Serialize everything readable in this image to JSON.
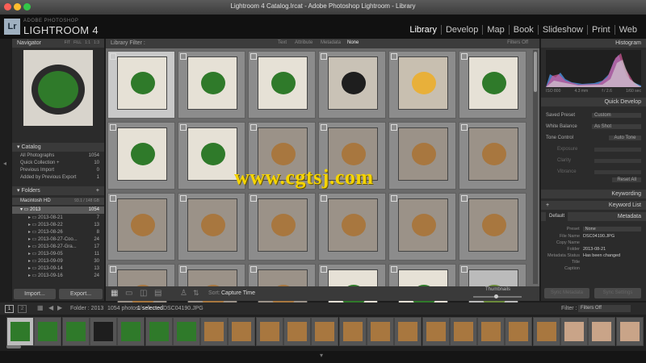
{
  "window": {
    "title": "Lightroom 4 Catalog.lrcat - Adobe Photoshop Lightroom - Library"
  },
  "brand": {
    "logo": "Lr",
    "sub": "ADOBE PHOTOSHOP",
    "main": "LIGHTROOM 4"
  },
  "modules": [
    "Library",
    "Develop",
    "Map",
    "Book",
    "Slideshow",
    "Print",
    "Web"
  ],
  "left": {
    "navigator": {
      "title": "Navigator",
      "zoom": [
        "FIT",
        "FILL",
        "1:1",
        "1:3"
      ]
    },
    "catalog": {
      "title": "Catalog",
      "items": [
        {
          "label": "All Photographs",
          "count": "1054"
        },
        {
          "label": "Quick Collection +",
          "count": "10"
        },
        {
          "label": "Previous Import",
          "count": "0"
        },
        {
          "label": "Added by Previous Export",
          "count": "1"
        }
      ]
    },
    "folders": {
      "title": "Folders",
      "volume": "Macintosh HD",
      "volume_space": "93.1 / 148 GB",
      "year": {
        "label": "2013",
        "count": "1054"
      },
      "items": [
        {
          "label": "2013-08-21",
          "count": "7"
        },
        {
          "label": "2013-08-22",
          "count": "13"
        },
        {
          "label": "2013-08-26",
          "count": "8"
        },
        {
          "label": "2013-08-27-Coo...",
          "count": "24"
        },
        {
          "label": "2013-08-27-Gra...",
          "count": "17"
        },
        {
          "label": "2013-09-05",
          "count": "11"
        },
        {
          "label": "2013-09-09",
          "count": "30"
        },
        {
          "label": "2013-09-14",
          "count": "13"
        },
        {
          "label": "2013-09-16",
          "count": "24"
        }
      ]
    },
    "import_label": "Import...",
    "export_label": "Export..."
  },
  "filter": {
    "label": "Library Filter :",
    "options": [
      "Text",
      "Attribute",
      "Metadata",
      "None"
    ],
    "active": "None",
    "preset": "Filters Off"
  },
  "toolbar": {
    "sort_label": "Sort:",
    "sort_value": "Capture Time",
    "thumbs_label": "Thumbnails"
  },
  "right": {
    "histogram": {
      "title": "Histogram",
      "iso": "ISO 800",
      "focal": "4.3 mm",
      "aperture": "f / 2.6",
      "shutter": "1/60 sec"
    },
    "quick_develop": {
      "title": "Quick Develop",
      "saved_preset_label": "Saved Preset",
      "saved_preset_value": "Custom",
      "wb_label": "White Balance",
      "wb_value": "As Shot",
      "tone_label": "Tone Control",
      "auto_tone": "Auto Tone",
      "exposure": "Exposure",
      "clarity": "Clarity",
      "vibrance": "Vibrance",
      "reset": "Reset All"
    },
    "keywording": "Keywording",
    "keyword_list": "Keyword List",
    "metadata": {
      "title": "Metadata",
      "mode": "Default",
      "preset_label": "Preset",
      "preset_value": "None",
      "fields": [
        {
          "label": "File Name",
          "value": "DSC04190.JPG"
        },
        {
          "label": "Copy Name",
          "value": ""
        },
        {
          "label": "Folder",
          "value": "2013-08-21"
        },
        {
          "label": "Metadata Status",
          "value": "Has been changed"
        },
        {
          "label": "Title",
          "value": ""
        },
        {
          "label": "Caption",
          "value": ""
        }
      ]
    },
    "sync_metadata": "Sync Metadata",
    "sync_settings": "Sync Settings"
  },
  "filmstrip": {
    "page1": "1",
    "page2": "2",
    "source": "Folder : 2013",
    "info": "1054 photos /",
    "selected": "1 selected",
    "file": "/DSC04190.JPG",
    "filter_label": "Filter :",
    "filter_value": "Filters Off"
  },
  "watermark": "www.cgtsj.com",
  "colors": {
    "accent_green": "#2f7a2a",
    "cookie": "#a8773f",
    "bg": "#1c1c1c",
    "watermark": "#f5d400"
  },
  "grid_photos": [
    "greens-bowl",
    "hand-greens",
    "greens-bowl",
    "pan-skillet",
    "lemons-tea",
    "greens-plate",
    "greens-tongs",
    "greens-leaves",
    "cookie-rack",
    "cookie-stack",
    "cookie-stack",
    "cookie-cloth",
    "cookie-stack-2",
    "cookie-single",
    "cookie-stack",
    "cookie-stack",
    "cookie-stack",
    "cookie-pile",
    "cookie-almonds",
    "cookie-dark",
    "cookie-partial",
    "greens-bowl",
    "greens-partial",
    "avocado-partial"
  ],
  "film_photos": 23
}
